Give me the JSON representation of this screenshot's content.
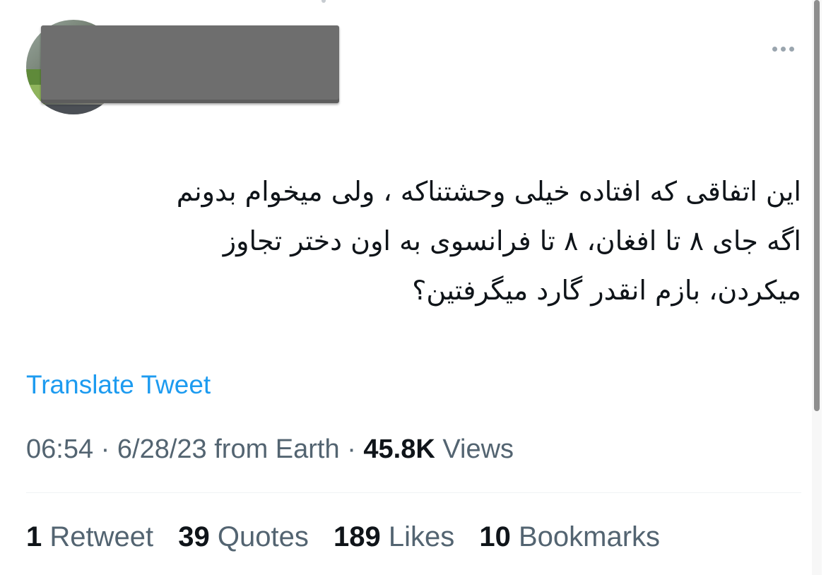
{
  "tweet": {
    "author": {
      "avatar_icon": "profile-photo",
      "name_redacted": true
    },
    "more_icon": "more-horizontal-icon",
    "text": "این اتفاقی که افتاده خیلی وحشتناکه ، ولی میخوام بدونم\nاگه جای ۸ تا افغان، ۸ تا فرانسوی به اون دختر تجاوز\nمیکردن، بازم انقدر گارد میگرفتین؟",
    "translate_label": "Translate Tweet",
    "time": "06:54",
    "date": "6/28/23",
    "source": "from Earth",
    "views_count": "45.8K",
    "views_label": "Views",
    "stats": [
      {
        "count": "1",
        "label": "Retweet"
      },
      {
        "count": "39",
        "label": "Quotes"
      },
      {
        "count": "189",
        "label": "Likes"
      },
      {
        "count": "10",
        "label": "Bookmarks"
      }
    ]
  },
  "colors": {
    "link": "#1d9bf0",
    "secondary_text": "#536471",
    "primary_text": "#0f1419",
    "divider": "#eff3f4"
  }
}
